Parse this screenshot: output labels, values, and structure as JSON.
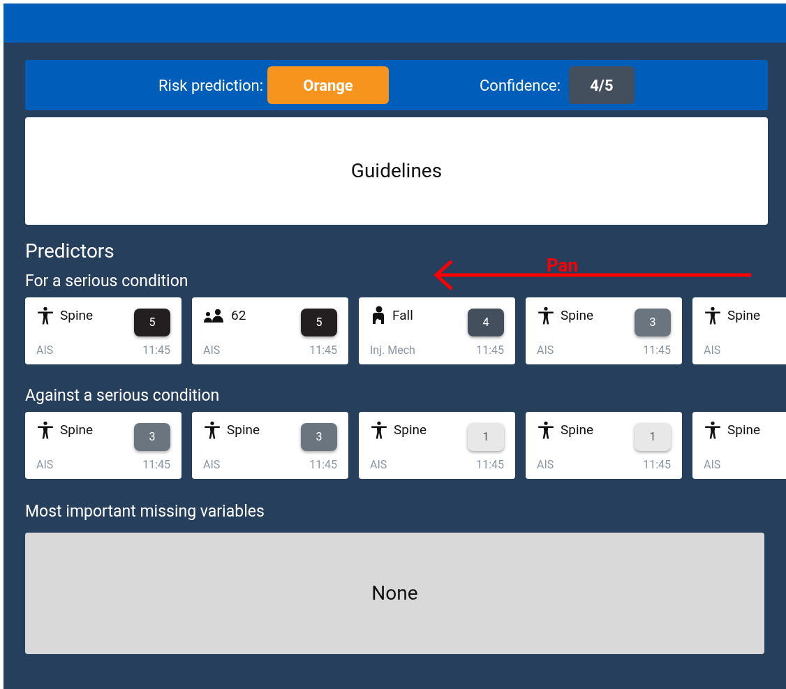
{
  "risk": {
    "label": "Risk prediction:",
    "value": "Orange",
    "color": "#f7941d"
  },
  "confidence": {
    "label": "Confidence:",
    "value": "4/5"
  },
  "guidelines": {
    "title": "Guidelines"
  },
  "predictors": {
    "title": "Predictors",
    "annotation": "Pan",
    "groups": [
      {
        "title": "For a serious condition",
        "cards": [
          {
            "kind": "body",
            "label": "Spine",
            "score": "5",
            "source": "AIS",
            "time": "11:45"
          },
          {
            "kind": "people",
            "label": "62",
            "score": "5",
            "source": "AIS",
            "time": "11:45"
          },
          {
            "kind": "fall",
            "label": "Fall",
            "score": "4",
            "source": "Inj. Mech",
            "time": "11:45"
          },
          {
            "kind": "body",
            "label": "Spine",
            "score": "3",
            "source": "AIS",
            "time": "11:45"
          },
          {
            "kind": "body",
            "label": "Spine",
            "source": "AIS"
          }
        ]
      },
      {
        "title": "Against a serious condition",
        "cards": [
          {
            "kind": "body",
            "label": "Spine",
            "score": "3",
            "source": "AIS",
            "time": "11:45"
          },
          {
            "kind": "body",
            "label": "Spine",
            "score": "3",
            "source": "AIS",
            "time": "11:45"
          },
          {
            "kind": "body",
            "label": "Spine",
            "score": "1",
            "source": "AIS",
            "time": "11:45"
          },
          {
            "kind": "body",
            "label": "Spine",
            "score": "1",
            "source": "AIS",
            "time": "11:45"
          },
          {
            "kind": "body",
            "label": "Spine",
            "source": "AIS"
          }
        ]
      }
    ]
  },
  "missing": {
    "title": "Most important missing variables",
    "value": "None"
  }
}
